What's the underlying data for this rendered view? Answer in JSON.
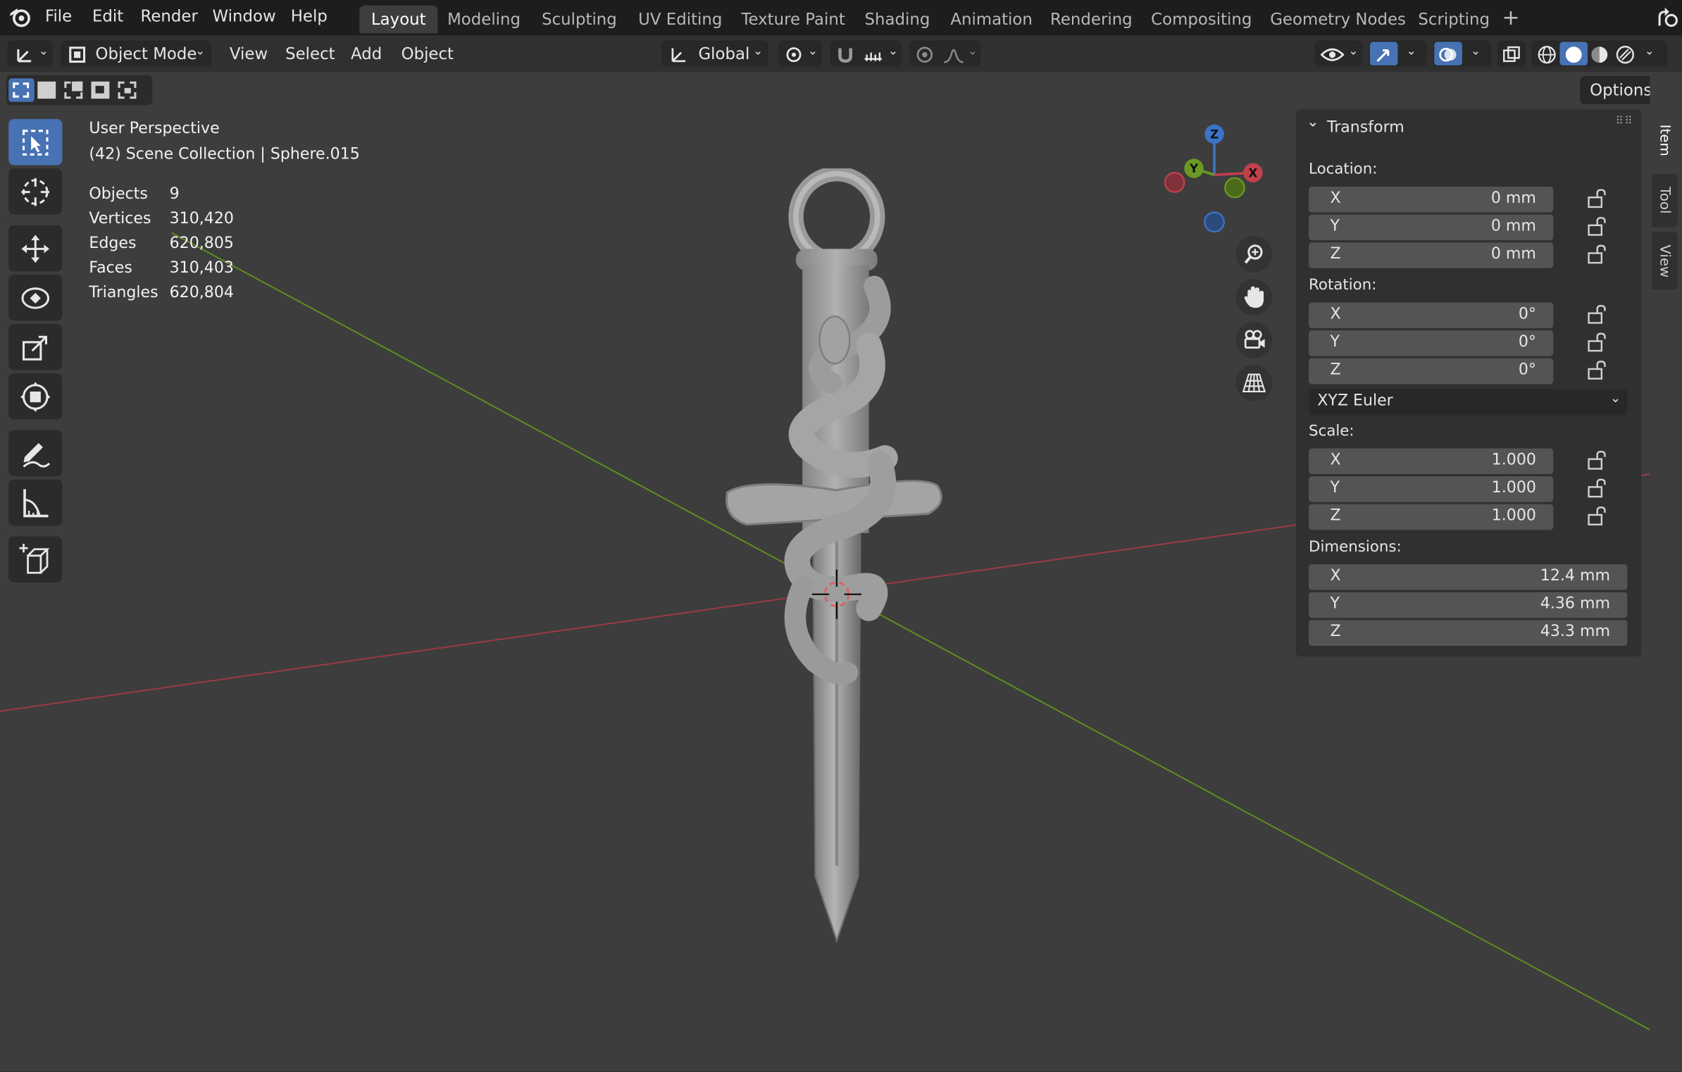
{
  "menubar": {
    "items": [
      "File",
      "Edit",
      "Render",
      "Window",
      "Help"
    ],
    "workspaces": [
      "Layout",
      "Modeling",
      "Sculpting",
      "UV Editing",
      "Texture Paint",
      "Shading",
      "Animation",
      "Rendering",
      "Compositing",
      "Geometry Nodes",
      "Scripting"
    ],
    "active_workspace": "Layout"
  },
  "header": {
    "mode": "Object Mode",
    "menus": [
      "View",
      "Select",
      "Add",
      "Object"
    ],
    "orientation": "Global",
    "options_label": "Options"
  },
  "overlay": {
    "view_name": "User Perspective",
    "collection": "(42) Scene Collection | Sphere.015",
    "stats": [
      {
        "label": "Objects",
        "value": "9"
      },
      {
        "label": "Vertices",
        "value": "310,420"
      },
      {
        "label": "Edges",
        "value": "620,805"
      },
      {
        "label": "Faces",
        "value": "310,403"
      },
      {
        "label": "Triangles",
        "value": "620,804"
      }
    ]
  },
  "gizmo": {
    "z": "Z",
    "y": "Y",
    "x": "X"
  },
  "transform": {
    "title": "Transform",
    "location_label": "Location:",
    "location": [
      {
        "axis": "X",
        "value": "0 mm"
      },
      {
        "axis": "Y",
        "value": "0 mm"
      },
      {
        "axis": "Z",
        "value": "0 mm"
      }
    ],
    "rotation_label": "Rotation:",
    "rotation": [
      {
        "axis": "X",
        "value": "0°"
      },
      {
        "axis": "Y",
        "value": "0°"
      },
      {
        "axis": "Z",
        "value": "0°"
      }
    ],
    "rotation_mode": "XYZ Euler",
    "scale_label": "Scale:",
    "scale": [
      {
        "axis": "X",
        "value": "1.000"
      },
      {
        "axis": "Y",
        "value": "1.000"
      },
      {
        "axis": "Z",
        "value": "1.000"
      }
    ],
    "dimensions_label": "Dimensions:",
    "dimensions": [
      {
        "axis": "X",
        "value": "12.4 mm"
      },
      {
        "axis": "Y",
        "value": "4.36 mm"
      },
      {
        "axis": "Z",
        "value": "43.3 mm"
      }
    ]
  },
  "sidebar_tabs": [
    "Item",
    "Tool",
    "View"
  ],
  "colors": {
    "accent": "#4772b3",
    "axis_x": "#c0404c",
    "axis_y": "#6a9a23",
    "axis_z": "#3b74c7"
  }
}
